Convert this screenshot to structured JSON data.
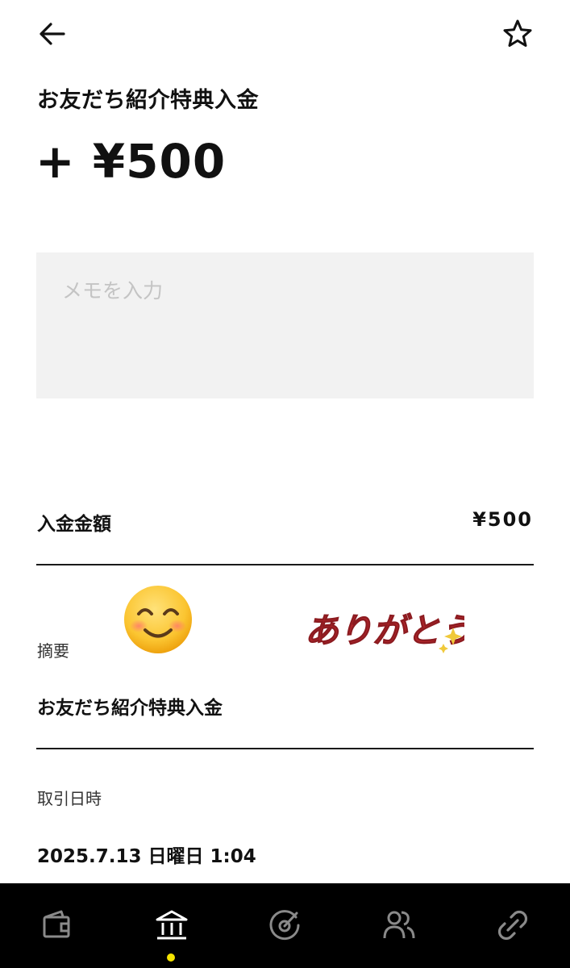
{
  "header": {
    "back_icon": "arrow-left-icon",
    "favorite_icon": "star-outline-icon"
  },
  "transaction": {
    "title": "お友だち紹介特典入金",
    "amount_display": "+ ¥500"
  },
  "memo": {
    "placeholder": "メモを入力",
    "value": ""
  },
  "details": {
    "deposit_amount_label": "入金金額",
    "deposit_amount_value": "¥500",
    "summary_label": "摘要",
    "summary_value": "お友だち紹介特典入金",
    "datetime_label": "取引日時",
    "datetime_value": "2025.7.13 日曜日 1:04"
  },
  "stickers": {
    "emoji": "smiling-face-emoji",
    "thanks_text": "ありがとう"
  },
  "bottom_nav": {
    "items": [
      {
        "icon": "wallet-icon",
        "active": false
      },
      {
        "icon": "bank-icon",
        "active": true
      },
      {
        "icon": "target-icon",
        "active": false
      },
      {
        "icon": "people-icon",
        "active": false
      },
      {
        "icon": "link-icon",
        "active": false
      }
    ],
    "active_color": "#f5e400"
  },
  "colors": {
    "memo_background": "#f2f2f2",
    "nav_background": "#000000",
    "icon_inactive": "#8a8a8a",
    "icon_active": "#ffffff",
    "sticker_red": "#b3262b"
  }
}
